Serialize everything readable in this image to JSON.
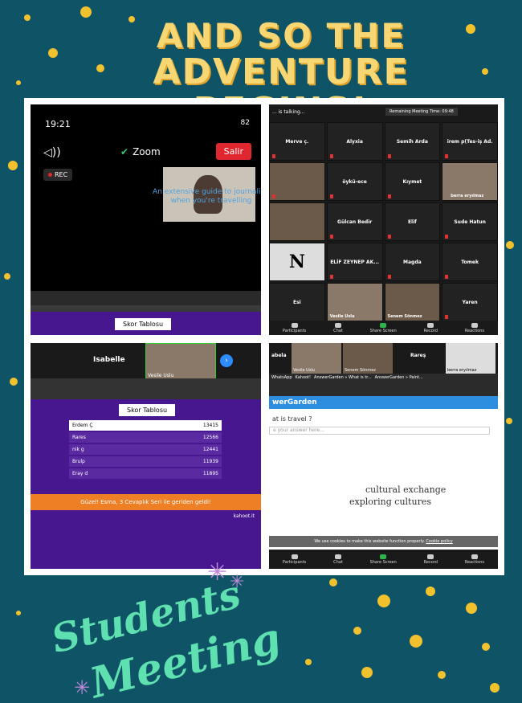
{
  "title": {
    "line1": "AND SO THE",
    "line2": "ADVENTURE BEGINS!"
  },
  "footer": {
    "line1": "Students",
    "line2": "Meeting"
  },
  "panel1": {
    "time": "19:21",
    "battery": "82",
    "zoom_label": "Zoom",
    "leave_label": "Salir",
    "rec_label": "REC",
    "overlay_line1": "An extensive guide to journaling",
    "overlay_line2": "when you're travelling",
    "score_label": "Skor Tablosu"
  },
  "panel2": {
    "talking": "... is talking...",
    "remaining": "Remaining Meeting Time: 09:48",
    "participants": [
      "Merve ç.",
      "Alyxia",
      "Semih Arda",
      "irem p(Tes-iş Ad.",
      "",
      "öykü-ece",
      "Kıymet",
      "berra eryılmaz",
      "",
      "Gülcan Bedir",
      "Elif",
      "Sude Hatun",
      "",
      "ELİF ZEYNEP AK...",
      "Magda",
      "Tomek",
      "Esi",
      "Vesile Uslu",
      "Senem Sönmez",
      "Yaren"
    ],
    "toolbar": [
      "Participants",
      "Chat",
      "Share Screen",
      "Record",
      "Reactions"
    ]
  },
  "panel3": {
    "isabelle": "Isabelle",
    "vesile": "Vesile Uslu",
    "score_label": "Skor Tablosu",
    "rows": [
      [
        "Erdem Ç",
        "13415"
      ],
      [
        "Rares",
        "12566"
      ],
      [
        "nik g",
        "12441"
      ],
      [
        "Brulp",
        "11939"
      ],
      [
        "Eray d",
        "11895"
      ]
    ],
    "banner": "Güzel! Esma, 3 Cevaplık Seri ile geriden geldi!",
    "kahoot": "kahoot.it"
  },
  "panel4": {
    "names": [
      "abela",
      "Vesile Uslu",
      "Senem Sönmez",
      "Rareş",
      "berra eryılmaz"
    ],
    "tabs": [
      "WhatsApp",
      "Kahoot!",
      "AnswerGarden » What is tr...",
      "AnswerGarden » Paint..."
    ],
    "brand": "werGarden",
    "question": "at is travel ?",
    "placeholder": "e your answer here...",
    "answer1": "cultural exchange",
    "answer2": "exploring cultures",
    "cookie": "We use cookies to make this website function properly.",
    "cookie_link": "Cookie policy",
    "toolbar": [
      "Participants",
      "Chat",
      "Share Screen",
      "Record",
      "Reactions"
    ]
  },
  "colors": {
    "background": "#0f5366",
    "dots": "#f2c12e",
    "title": "#f7d774",
    "script": "#5fe0b0"
  }
}
